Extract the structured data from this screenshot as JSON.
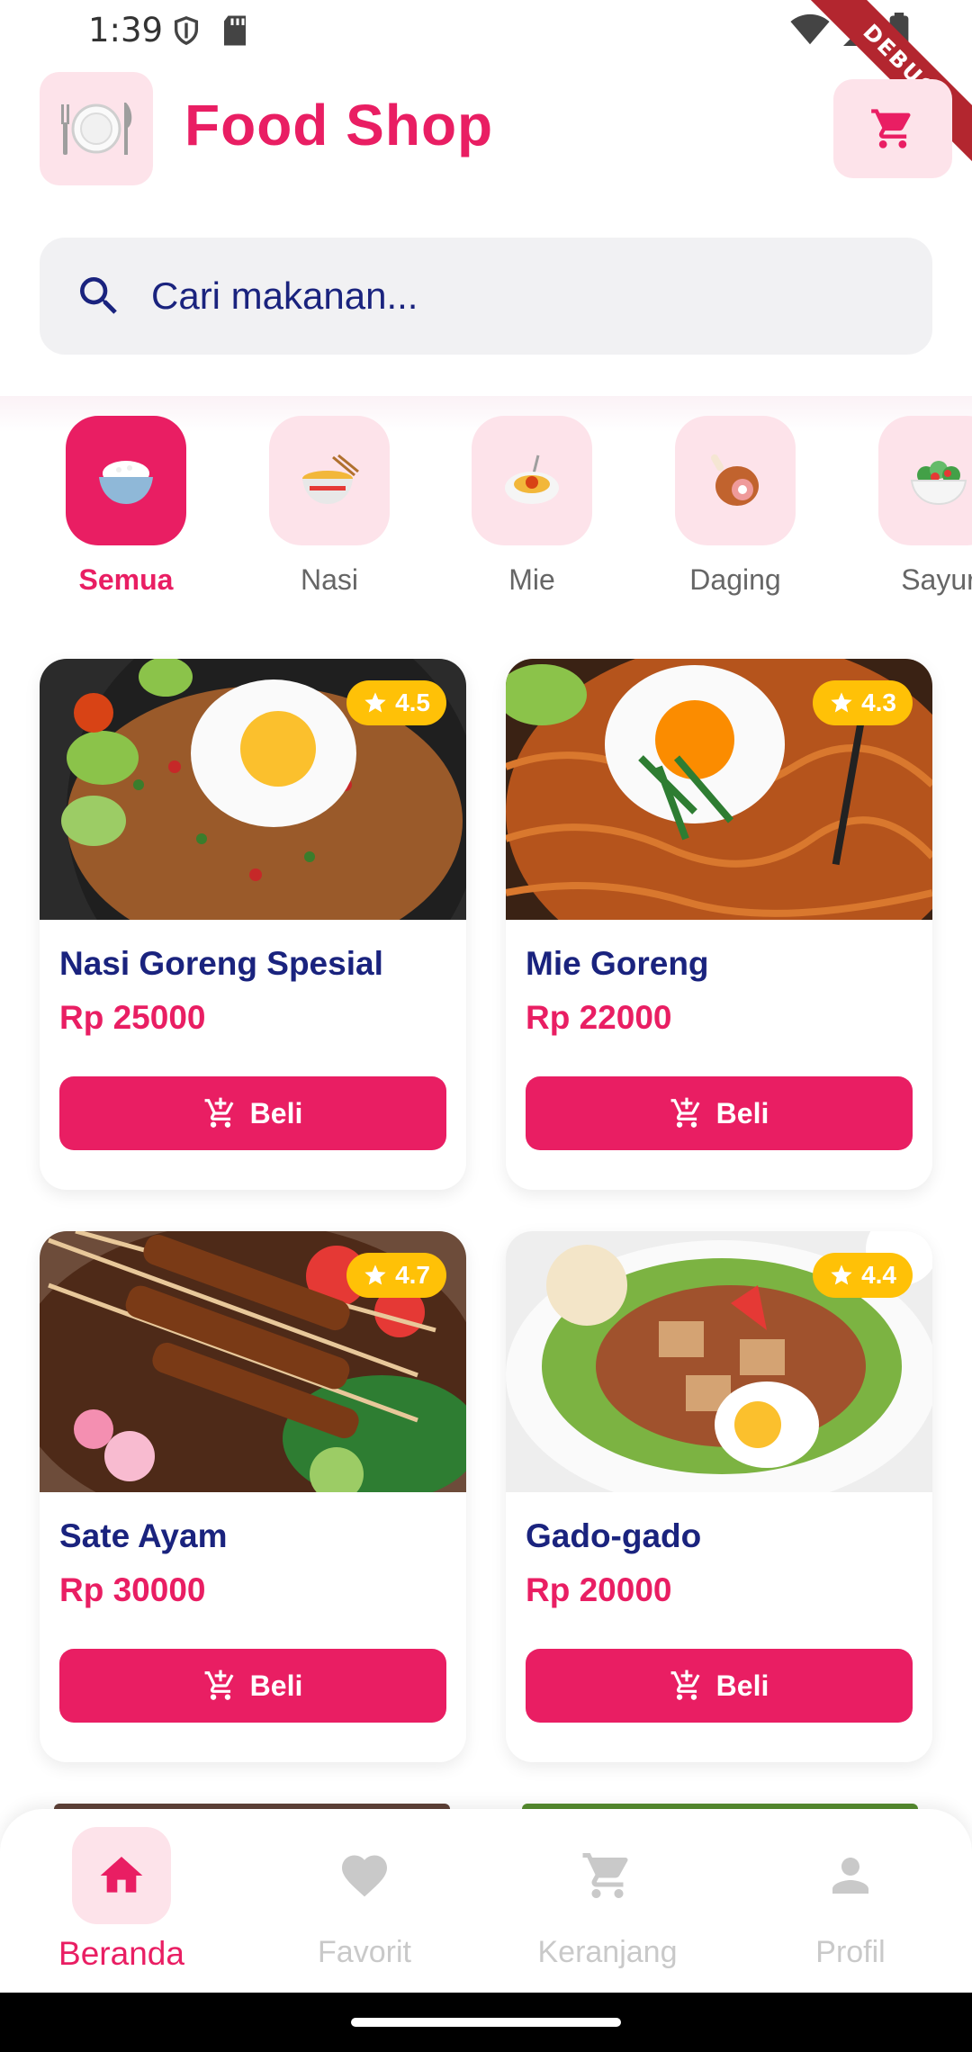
{
  "status": {
    "time": "1:39"
  },
  "debug_label": "DEBUG",
  "app": {
    "title": "Food Shop"
  },
  "search": {
    "placeholder": "Cari makanan..."
  },
  "categories": [
    {
      "label": "Semua",
      "icon": "rice-bowl-icon",
      "active": true
    },
    {
      "label": "Nasi",
      "icon": "noodle-bowl-icon",
      "active": false
    },
    {
      "label": "Mie",
      "icon": "spaghetti-icon",
      "active": false
    },
    {
      "label": "Daging",
      "icon": "meat-icon",
      "active": false
    },
    {
      "label": "Sayur",
      "icon": "salad-icon",
      "active": false
    }
  ],
  "products": [
    {
      "name": "Nasi Goreng Spesial",
      "price": "Rp 25000",
      "rating": "4.5",
      "button": "Beli"
    },
    {
      "name": "Mie Goreng",
      "price": "Rp 22000",
      "rating": "4.3",
      "button": "Beli"
    },
    {
      "name": "Sate Ayam",
      "price": "Rp 30000",
      "rating": "4.7",
      "button": "Beli"
    },
    {
      "name": "Gado-gado",
      "price": "Rp 20000",
      "rating": "4.4",
      "button": "Beli"
    }
  ],
  "nav": [
    {
      "label": "Beranda",
      "icon": "home-icon",
      "active": true
    },
    {
      "label": "Favorit",
      "icon": "heart-icon",
      "active": false
    },
    {
      "label": "Keranjang",
      "icon": "cart-icon",
      "active": false
    },
    {
      "label": "Profil",
      "icon": "person-icon",
      "active": false
    }
  ],
  "colors": {
    "accent": "#e91e63",
    "accent_light": "#fde3ea",
    "title_text": "#1a237e",
    "rating": "#ffc107"
  }
}
